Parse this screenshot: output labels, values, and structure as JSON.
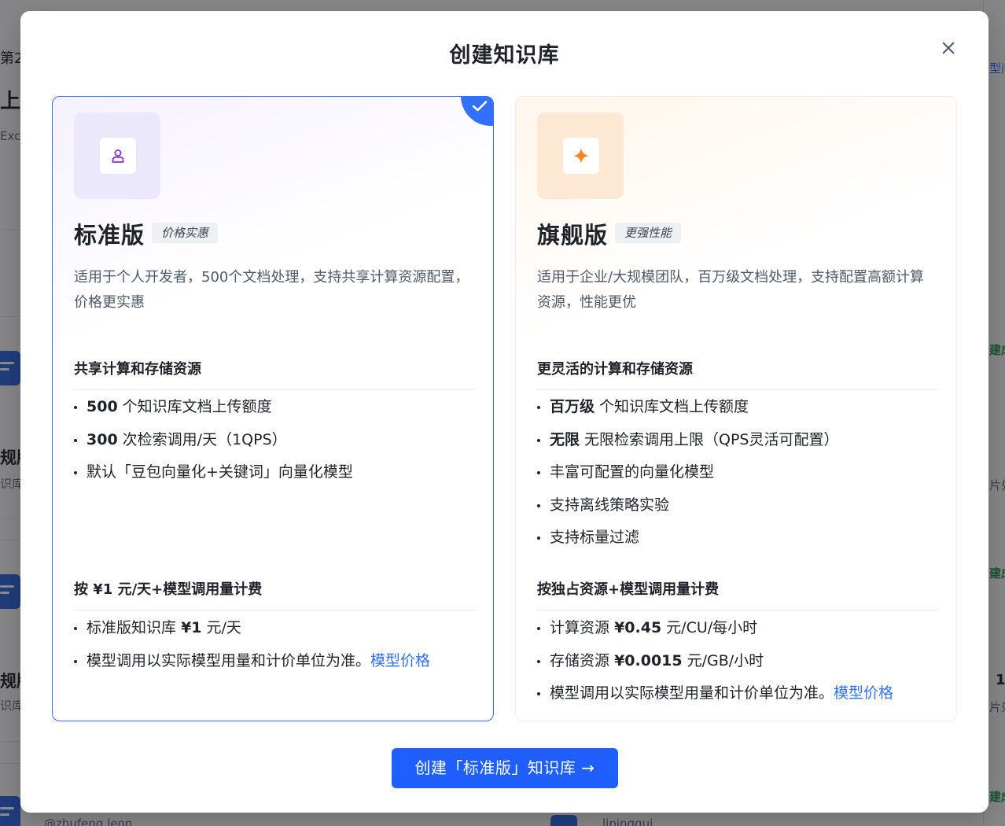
{
  "background": {
    "fragments": [
      "第2",
      "上传",
      "Exce",
      "规版",
      "识库",
      "规版",
      "识库",
      "@zhufeng.leon",
      "lipinggui",
      "型问",
      "建成",
      "片处",
      "建成",
      "1",
      "片处",
      "建成"
    ]
  },
  "modal": {
    "title": "创建知识库",
    "close_label": "×"
  },
  "cards": {
    "standard": {
      "name": "标准版",
      "tag": "价格实惠",
      "description": "适用于个人开发者，500个文档处理，支持共享计算资源配置，价格更实惠",
      "section1_title": "共享计算和存储资源",
      "features": [
        {
          "bold": "500",
          "text": "个知识库文档上传额度"
        },
        {
          "bold": "300",
          "text": "次检索调用/天（1QPS）"
        },
        {
          "bold": "",
          "text": "默认「豆包向量化+关键词」向量化模型"
        }
      ],
      "section2_title": "按 ¥1 元/天+模型调用量计费",
      "billing": [
        {
          "prefix": "标准版知识库",
          "bold": "¥1",
          "text": "元/天"
        },
        {
          "prefix": "模型调用以实际模型用量和计价单位为准。",
          "bold": "",
          "text": "",
          "link": "模型价格"
        }
      ],
      "selected": true,
      "icon": "user-icon",
      "icon_color": "#8a2be2"
    },
    "flagship": {
      "name": "旗舰版",
      "tag": "更强性能",
      "description": "适用于企业/大规模团队，百万级文档处理，支持配置高额计算资源，性能更优",
      "section1_title": "更灵活的计算和存储资源",
      "features": [
        {
          "bold": "百万级",
          "text": "个知识库文档上传额度"
        },
        {
          "bold": "无限",
          "text": "无限检索调用上限（QPS灵活可配置）"
        },
        {
          "bold": "",
          "text": "丰富可配置的向量化模型"
        },
        {
          "bold": "",
          "text": "支持离线策略实验"
        },
        {
          "bold": "",
          "text": "支持标量过滤"
        }
      ],
      "section2_title": "按独占资源+模型调用量计费",
      "billing": [
        {
          "prefix": "计算资源",
          "bold": "¥0.45",
          "text": "元/CU/每小时"
        },
        {
          "prefix": "存储资源",
          "bold": "¥0.0015",
          "text": "元/GB/小时"
        },
        {
          "prefix": "模型调用以实际模型用量和计价单位为准。",
          "bold": "",
          "text": "",
          "link": "模型价格"
        }
      ],
      "selected": false,
      "icon": "sparkle-icon",
      "icon_color": "#f5861f"
    }
  },
  "cta_label": "创建「标准版」知识库 →",
  "colors": {
    "accent": "#3370ff",
    "cta": "#1f5eff"
  }
}
